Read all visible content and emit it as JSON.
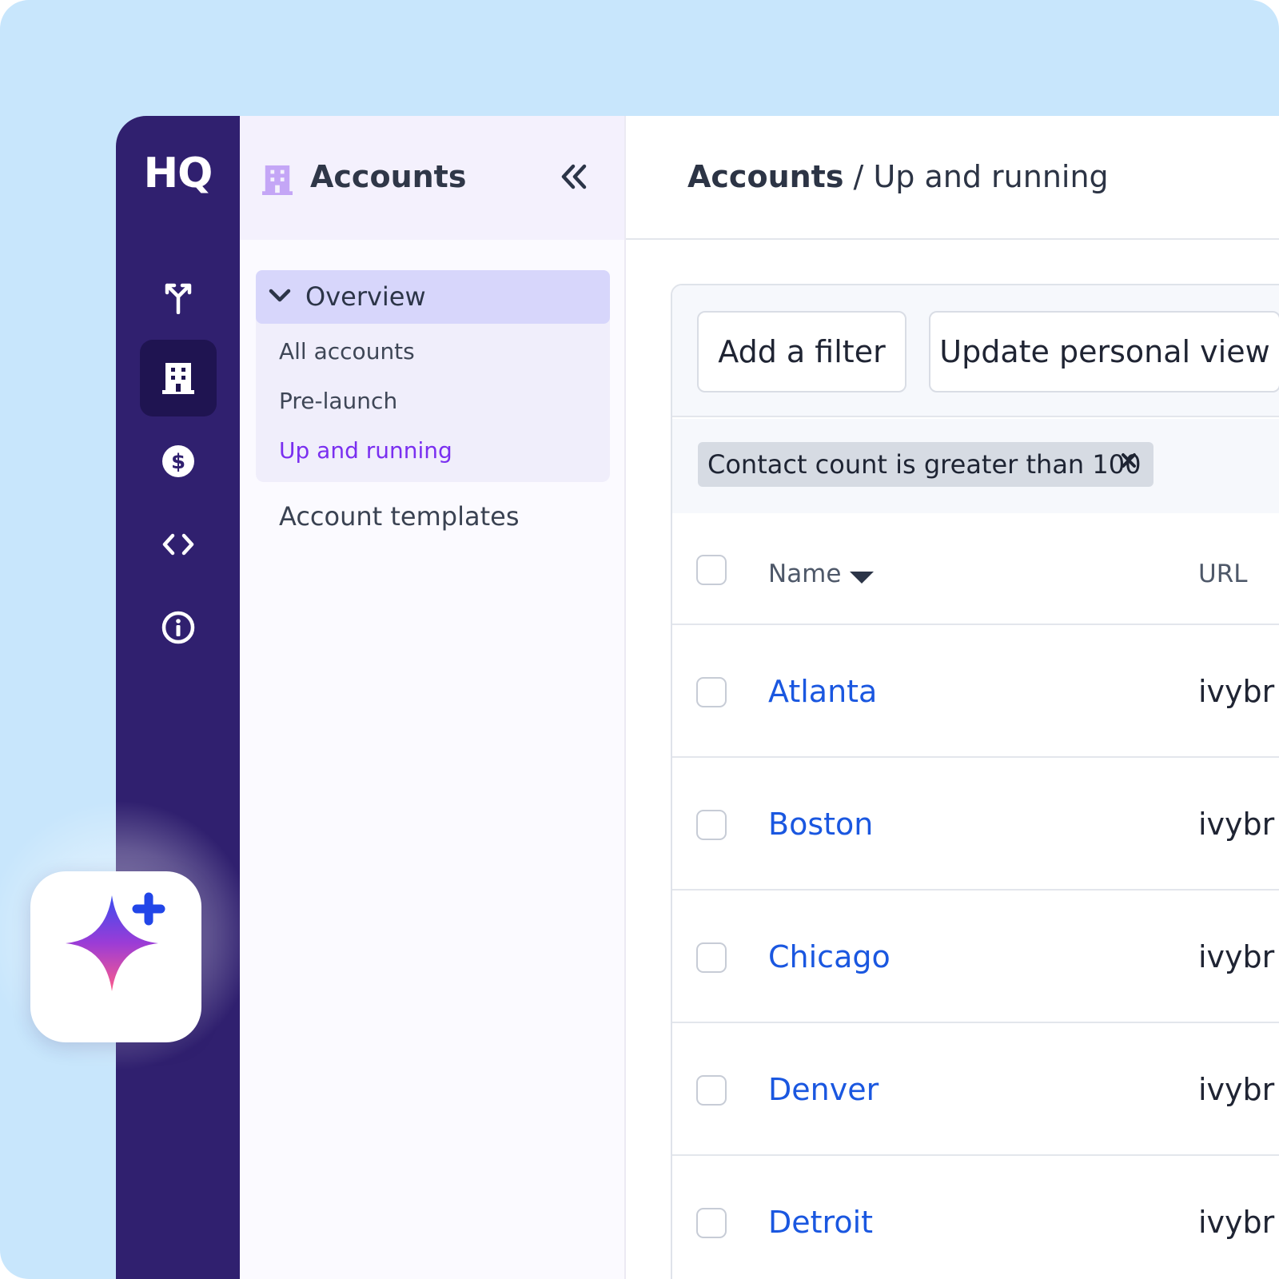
{
  "app": {
    "logo": "HQ"
  },
  "rail": {
    "items": [
      {
        "icon": "branch-icon"
      },
      {
        "icon": "building-icon",
        "active": true
      },
      {
        "icon": "dollar-icon"
      },
      {
        "icon": "code-icon"
      },
      {
        "icon": "info-icon"
      }
    ]
  },
  "nav": {
    "title": "Accounts",
    "group": {
      "label": "Overview",
      "items": [
        {
          "label": "All accounts"
        },
        {
          "label": "Pre-launch"
        },
        {
          "label": "Up and running",
          "selected": true
        }
      ]
    },
    "templates_label": "Account templates"
  },
  "breadcrumb": {
    "root": "Accounts",
    "separator": " / ",
    "current": "Up and running"
  },
  "toolbar": {
    "add_filter": "Add a filter",
    "update_view": "Update personal view"
  },
  "filter_chip": {
    "label": "Contact count is greater than 100"
  },
  "table": {
    "columns": [
      "Name",
      "URL"
    ],
    "rows": [
      {
        "name": "Atlanta",
        "url": "ivybr"
      },
      {
        "name": "Boston",
        "url": "ivybr"
      },
      {
        "name": "Chicago",
        "url": "ivybr"
      },
      {
        "name": "Denver",
        "url": "ivybr"
      },
      {
        "name": "Detroit",
        "url": "ivybr"
      }
    ]
  },
  "colors": {
    "rail": "#30206f",
    "accent": "#7a2ff0",
    "link": "#1a57e0",
    "background": "#c8e6fc"
  }
}
